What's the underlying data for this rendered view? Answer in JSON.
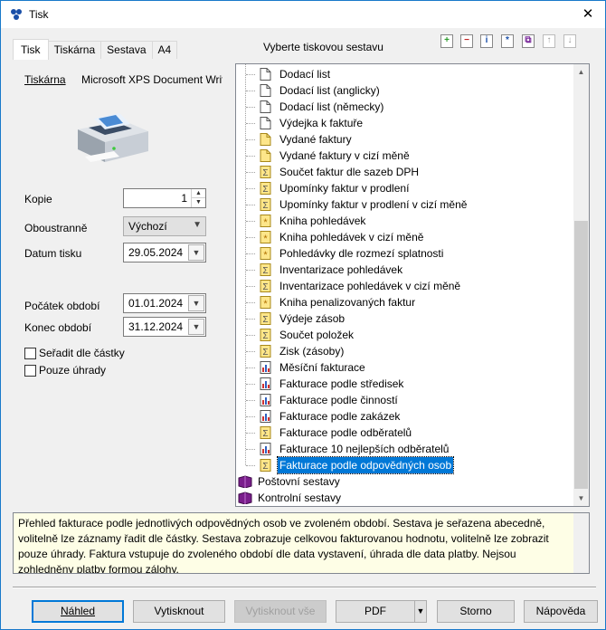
{
  "window": {
    "title": "Tisk",
    "close": "✕"
  },
  "tabs": [
    {
      "label": "Tisk",
      "active": true
    },
    {
      "label": "Tiskárna"
    },
    {
      "label": "Sestava"
    },
    {
      "label": "A4"
    }
  ],
  "print_tab": {
    "printer_label": "Tiskárna",
    "printer_name": "Microsoft XPS Document Writer",
    "copies_label": "Kopie",
    "copies_value": "1",
    "duplex_label": "Oboustranně",
    "duplex_value": "Výchozí",
    "print_date_label": "Datum tisku",
    "print_date_value": "29.05.2024",
    "period_start_label": "Počátek období",
    "period_start_value": "01.01.2024",
    "period_end_label": "Konec období",
    "period_end_value": "31.12.2024",
    "sort_by_amount_label": "Seřadit dle částky",
    "payments_only_label": "Pouze úhrady"
  },
  "report_panel": {
    "title": "Vyberte tiskovou sestavu",
    "toolbar_icons": [
      "add-icon",
      "remove-icon",
      "info-icon",
      "star-icon",
      "copy-icon",
      "move-up-icon",
      "move-down-icon"
    ]
  },
  "tree_items": [
    {
      "label": "Dodací list",
      "icon": "document-icon"
    },
    {
      "label": "Dodací list (anglicky)",
      "icon": "document-icon"
    },
    {
      "label": "Dodací list (německy)",
      "icon": "document-icon"
    },
    {
      "label": "Výdejka k faktuře",
      "icon": "document-icon"
    },
    {
      "label": "Vydané faktury",
      "icon": "yellow-document-icon"
    },
    {
      "label": "Vydané faktury v cizí měně",
      "icon": "yellow-document-icon"
    },
    {
      "label": "Součet faktur dle sazeb DPH",
      "icon": "sum-icon"
    },
    {
      "label": "Upomínky faktur v prodlení",
      "icon": "sum-icon"
    },
    {
      "label": "Upomínky faktur v prodlení v cizí měně",
      "icon": "sum-icon"
    },
    {
      "label": "Kniha pohledávek",
      "icon": "star-document-icon"
    },
    {
      "label": "Kniha pohledávek v cizí měně",
      "icon": "star-document-icon"
    },
    {
      "label": "Pohledávky dle rozmezí splatnosti",
      "icon": "star-document-icon"
    },
    {
      "label": "Inventarizace pohledávek",
      "icon": "sum-icon"
    },
    {
      "label": "Inventarizace pohledávek v cizí měně",
      "icon": "sum-icon"
    },
    {
      "label": "Kniha penalizovaných faktur",
      "icon": "star-document-icon"
    },
    {
      "label": "Výdeje zásob",
      "icon": "sum-icon"
    },
    {
      "label": "Součet položek",
      "icon": "sum-icon"
    },
    {
      "label": "Zisk (zásoby)",
      "icon": "sum-icon"
    },
    {
      "label": "Měsíční fakturace",
      "icon": "chart-icon"
    },
    {
      "label": "Fakturace podle středisek",
      "icon": "chart-icon"
    },
    {
      "label": "Fakturace podle činností",
      "icon": "chart-icon"
    },
    {
      "label": "Fakturace podle zakázek",
      "icon": "chart-icon"
    },
    {
      "label": "Fakturace podle odběratelů",
      "icon": "sum-icon"
    },
    {
      "label": "Fakturace 10 nejlepších odběratelů",
      "icon": "chart-icon"
    },
    {
      "label": "Fakturace podle odpovědných osob",
      "icon": "sum-icon",
      "selected": true
    }
  ],
  "tree_groups": [
    {
      "label": "Poštovní sestavy",
      "icon": "book-icon"
    },
    {
      "label": "Kontrolní sestavy",
      "icon": "book-icon"
    }
  ],
  "description": "Přehled fakturace podle jednotlivých odpovědných osob ve zvoleném období. Sestava je seřazena abecedně, volitelně lze záznamy řadit dle částky. Sestava zobrazuje celkovou fakturovanou hodnotu, volitelně lze zobrazit pouze úhrady. Faktura vstupuje do zvoleného období dle data vystavení, úhrada dle data platby. Nejsou zohledněny platby formou zálohy.",
  "buttons": {
    "preview": "Náhled",
    "print": "Vytisknout",
    "print_all": "Vytisknout vše",
    "pdf": "PDF",
    "cancel": "Storno",
    "help": "Nápověda"
  },
  "colors": {
    "accent": "#0078d7",
    "description_bg": "#fefee6"
  }
}
